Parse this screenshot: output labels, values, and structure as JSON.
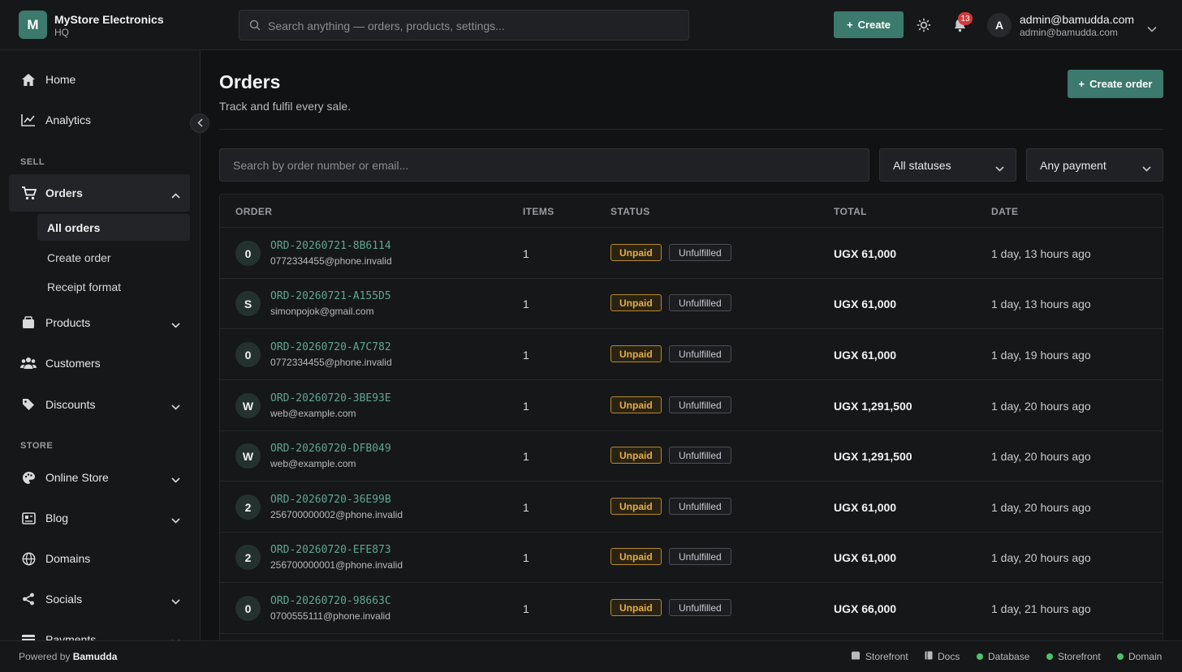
{
  "header": {
    "brand_initial": "M",
    "brand_name": "MyStore Electronics",
    "brand_sub": "HQ",
    "search_placeholder": "Search anything — orders, products, settings...",
    "create_label": "Create",
    "notification_count": "13",
    "user_initial": "A",
    "user_name": "admin@bamudda.com",
    "user_email": "admin@bamudda.com"
  },
  "sidebar": {
    "home": "Home",
    "analytics": "Analytics",
    "sell_label": "SELL",
    "orders": "Orders",
    "orders_sub": [
      "All orders",
      "Create order",
      "Receipt format"
    ],
    "products": "Products",
    "customers": "Customers",
    "discounts": "Discounts",
    "store_label": "STORE",
    "online_store": "Online Store",
    "blog": "Blog",
    "domains": "Domains",
    "socials": "Socials",
    "payments": "Payments"
  },
  "main": {
    "title": "Orders",
    "subtitle": "Track and fulfil every sale.",
    "create_order_label": "Create order",
    "search_placeholder": "Search by order number or email...",
    "status_filter": "All statuses",
    "payment_filter": "Any payment",
    "columns": [
      "ORDER",
      "ITEMS",
      "STATUS",
      "TOTAL",
      "DATE"
    ],
    "rows": [
      {
        "initial": "0",
        "order": "ORD-20260721-8B6114",
        "email": "0772334455@phone.invalid",
        "items": "1",
        "payment": "Unpaid",
        "fulfillment": "Unfulfilled",
        "total": "UGX 61,000",
        "date": "1 day, 13 hours ago"
      },
      {
        "initial": "S",
        "order": "ORD-20260721-A155D5",
        "email": "simonpojok@gmail.com",
        "items": "1",
        "payment": "Unpaid",
        "fulfillment": "Unfulfilled",
        "total": "UGX 61,000",
        "date": "1 day, 13 hours ago"
      },
      {
        "initial": "0",
        "order": "ORD-20260720-A7C782",
        "email": "0772334455@phone.invalid",
        "items": "1",
        "payment": "Unpaid",
        "fulfillment": "Unfulfilled",
        "total": "UGX 61,000",
        "date": "1 day, 19 hours ago"
      },
      {
        "initial": "W",
        "order": "ORD-20260720-3BE93E",
        "email": "web@example.com",
        "items": "1",
        "payment": "Unpaid",
        "fulfillment": "Unfulfilled",
        "total": "UGX 1,291,500",
        "date": "1 day, 20 hours ago"
      },
      {
        "initial": "W",
        "order": "ORD-20260720-DFB049",
        "email": "web@example.com",
        "items": "1",
        "payment": "Unpaid",
        "fulfillment": "Unfulfilled",
        "total": "UGX 1,291,500",
        "date": "1 day, 20 hours ago"
      },
      {
        "initial": "2",
        "order": "ORD-20260720-36E99B",
        "email": "256700000002@phone.invalid",
        "items": "1",
        "payment": "Unpaid",
        "fulfillment": "Unfulfilled",
        "total": "UGX 61,000",
        "date": "1 day, 20 hours ago"
      },
      {
        "initial": "2",
        "order": "ORD-20260720-EFE873",
        "email": "256700000001@phone.invalid",
        "items": "1",
        "payment": "Unpaid",
        "fulfillment": "Unfulfilled",
        "total": "UGX 61,000",
        "date": "1 day, 20 hours ago"
      },
      {
        "initial": "0",
        "order": "ORD-20260720-98663C",
        "email": "0700555111@phone.invalid",
        "items": "1",
        "payment": "Unpaid",
        "fulfillment": "Unfulfilled",
        "total": "UGX 66,000",
        "date": "1 day, 21 hours ago"
      }
    ]
  },
  "footer": {
    "powered_prefix": "Powered by",
    "powered_brand": "Bamudda",
    "links": [
      "Storefront",
      "Docs"
    ],
    "status": [
      "Database",
      "Storefront",
      "Domain"
    ]
  },
  "colors": {
    "accent": "#3b7a6c",
    "order_link": "#5fa694",
    "unpaid": "#e3b04b",
    "status_ok": "#4cc36b",
    "badge": "#d03a3a"
  }
}
